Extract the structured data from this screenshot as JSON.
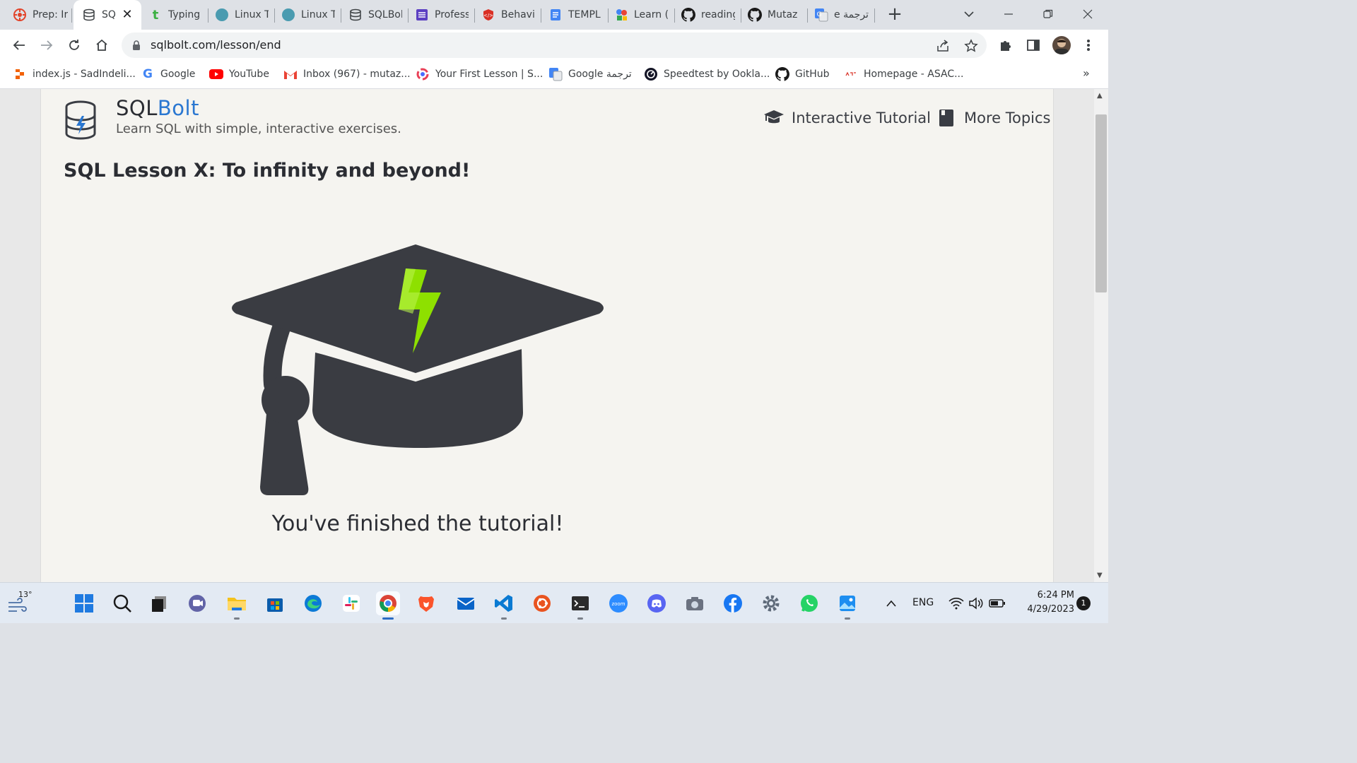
{
  "browser": {
    "tabs": [
      {
        "title": "Prep: Ir",
        "icon": "gitlab-icon"
      },
      {
        "title": "SQ",
        "icon": "database-icon",
        "active": true
      },
      {
        "title": "Typing",
        "icon": "typing-icon"
      },
      {
        "title": "Linux T",
        "icon": "circle-icon"
      },
      {
        "title": "Linux T",
        "icon": "circle-icon"
      },
      {
        "title": "SQLBol",
        "icon": "database-icon"
      },
      {
        "title": "Profess",
        "icon": "list-icon"
      },
      {
        "title": "Behavi",
        "icon": "shield-code-icon"
      },
      {
        "title": "TEMPL",
        "icon": "doc-icon"
      },
      {
        "title": "Learn (",
        "icon": "shapes-icon"
      },
      {
        "title": "reading",
        "icon": "github-icon"
      },
      {
        "title": "Mutaz",
        "icon": "github-icon"
      },
      {
        "title": "e ترجمة",
        "icon": "translate-icon"
      }
    ],
    "url": "sqlbolt.com/lesson/end",
    "bookmarks": [
      {
        "title": "index.js - SadIndeli...",
        "icon": "replit-icon"
      },
      {
        "title": "Google",
        "icon": "google-icon"
      },
      {
        "title": "YouTube",
        "icon": "youtube-icon"
      },
      {
        "title": "Inbox (967) - mutaz...",
        "icon": "gmail-icon"
      },
      {
        "title": "Your First Lesson | S...",
        "icon": "swirl-icon"
      },
      {
        "title": "Google ترجمة",
        "icon": "translate-icon"
      },
      {
        "title": "Speedtest by Ookla...",
        "icon": "speedtest-icon"
      },
      {
        "title": "GitHub",
        "icon": "github-icon"
      },
      {
        "title": "Homepage - ASAC...",
        "icon": "asac-icon"
      }
    ],
    "bookmarks_more": "»"
  },
  "page": {
    "brand_prefix": "SQL",
    "brand_suffix": "Bolt",
    "tagline": "Learn SQL with simple, interactive exercises.",
    "nav": {
      "tutorial": "Interactive Tutorial",
      "topics": "More Topics"
    },
    "lesson_title": "SQL Lesson X: To infinity and beyond!",
    "finished_message": "You've finished the tutorial!",
    "colors": {
      "brand_accent": "#2a77d1",
      "cap": "#3a3c42",
      "bolt": "#8ee000"
    }
  },
  "taskbar": {
    "weather_temp": "13°",
    "apps": [
      "start-icon",
      "search-icon",
      "task-view-icon",
      "chat-icon",
      "file-explorer-icon",
      "store-icon",
      "edge-icon",
      "slack-icon",
      "chrome-icon",
      "brave-icon",
      "mail-icon",
      "vscode-icon",
      "ubuntu-icon",
      "terminal-icon",
      "zoom-icon",
      "discord-icon",
      "camera-icon",
      "facebook-icon",
      "settings-icon",
      "whatsapp-icon",
      "photos-icon"
    ],
    "language": "ENG",
    "time": "6:24 PM",
    "date": "4/29/2023",
    "notifications": "1"
  }
}
